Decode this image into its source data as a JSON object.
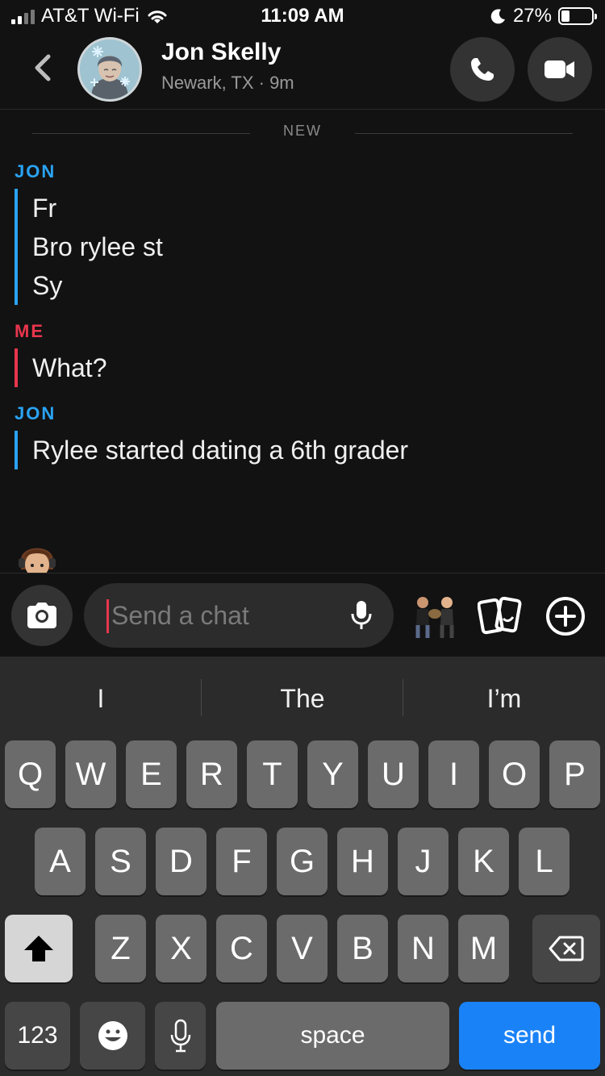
{
  "status_bar": {
    "carrier": "AT&T Wi-Fi",
    "time": "11:09 AM",
    "battery_percent": "27%",
    "battery_level": 0.27
  },
  "header": {
    "contact_name": "Jon Skelly",
    "contact_subtitle": "Newark, TX · 9m"
  },
  "chat": {
    "divider_label": "NEW",
    "groups": [
      {
        "sender": "JON",
        "messages": [
          "Fr",
          "Bro rylee st",
          "Sy"
        ]
      },
      {
        "sender": "ME",
        "messages": [
          "What?"
        ]
      },
      {
        "sender": "JON",
        "messages": [
          "Rylee started dating a 6th grader"
        ]
      }
    ]
  },
  "input": {
    "placeholder": "Send a chat"
  },
  "keyboard": {
    "suggestions": [
      "I",
      "The",
      "I’m"
    ],
    "row1": [
      "Q",
      "W",
      "E",
      "R",
      "T",
      "Y",
      "U",
      "I",
      "O",
      "P"
    ],
    "row2": [
      "A",
      "S",
      "D",
      "F",
      "G",
      "H",
      "J",
      "K",
      "L"
    ],
    "row3": [
      "Z",
      "X",
      "C",
      "V",
      "B",
      "N",
      "M"
    ],
    "numbers_label": "123",
    "space_label": "space",
    "send_label": "send"
  },
  "colors": {
    "friend_accent": "#2aa3f4",
    "me_accent": "#e8364d",
    "send_button": "#1a82f7",
    "background": "#121212"
  }
}
